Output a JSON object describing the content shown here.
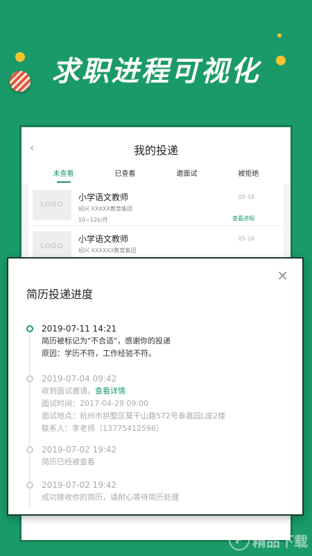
{
  "headline": "求职进程可视化",
  "phone": {
    "back_icon": "‹",
    "title": "我的投递",
    "tabs": [
      {
        "label": "未查看",
        "active": true
      },
      {
        "label": "已查看",
        "active": false
      },
      {
        "label": "邀面试",
        "active": false
      },
      {
        "label": "被拒绝",
        "active": false
      }
    ],
    "jobs": [
      {
        "logo": "LOGO",
        "title": "小学语文教师",
        "org": "绍兴  XXXXX教育集团",
        "salary": "10~12k/月",
        "date": "05-18",
        "link": "查看进程"
      },
      {
        "logo": "LOGO",
        "title": "小学语文教师",
        "org": "绍兴  XXXXXX教育集团",
        "salary": "",
        "date": "05-16",
        "link": ""
      }
    ]
  },
  "modal": {
    "title": "简历投递进度",
    "close_icon": "×",
    "entries": [
      {
        "time": "2019-07-11  14:21",
        "line1": "简历被标记为\"不合适\"，感谢你的投递",
        "line2": "原因：学历不符，工作经验不符。"
      },
      {
        "time": "2019-07-04  09:42",
        "line1": "收到面试邀请，",
        "link": "查看详情",
        "line2": "面试时间：2017-04-29 09:00",
        "line3": "面试地点：杭州市拱墅区莫干山路572号泰嘉园L座2楼",
        "line4": "联系人：李老师（13775412596）"
      },
      {
        "time": "2019-07-02  19:42",
        "line1": "简历已经被查看"
      },
      {
        "time": "2019-07-02  19:42",
        "line1": "成功接收你的简历，请耐心等待简历处理"
      }
    ]
  },
  "watermark": {
    "mark": "P",
    "text": "精品下载"
  },
  "colors": {
    "brand_green": "#1a9a68",
    "accent_yellow": "#f4c430",
    "ball_red": "#e2533f"
  }
}
